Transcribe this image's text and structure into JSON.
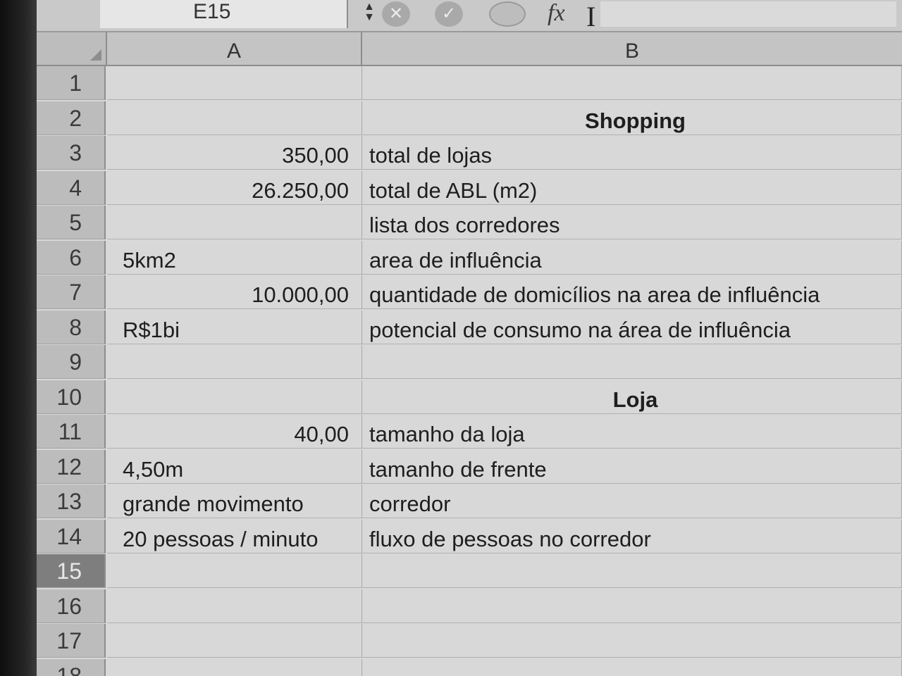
{
  "formula_bar": {
    "cell_ref": "E15",
    "cancel_icon": "close-icon",
    "confirm_icon": "check-icon",
    "function_icon": "fx-icon",
    "fx_label": "fx",
    "cursor_glyph": "I"
  },
  "columns": [
    "A",
    "B"
  ],
  "active_row": "15",
  "rows": [
    {
      "num": "1",
      "a": "",
      "b": ""
    },
    {
      "num": "2",
      "a": "",
      "b": "Shopping"
    },
    {
      "num": "3",
      "a": "350,00",
      "b": "total de lojas"
    },
    {
      "num": "4",
      "a": "26.250,00",
      "b": "total de ABL (m2)"
    },
    {
      "num": "5",
      "a": "",
      "b": "lista dos corredores"
    },
    {
      "num": "6",
      "a": "5km2",
      "b": "area de influência"
    },
    {
      "num": "7",
      "a": "10.000,00",
      "b": "quantidade de domicílios na area de influência"
    },
    {
      "num": "8",
      "a": "R$1bi",
      "b": "potencial de consumo na área de influência"
    },
    {
      "num": "9",
      "a": "",
      "b": ""
    },
    {
      "num": "10",
      "a": "",
      "b": "Loja"
    },
    {
      "num": "11",
      "a": "40,00",
      "b": "tamanho da loja"
    },
    {
      "num": "12",
      "a": "4,50m",
      "b": "tamanho de frente"
    },
    {
      "num": "13",
      "a": "grande movimento",
      "b": "corredor"
    },
    {
      "num": "14",
      "a": "20 pessoas / minuto",
      "b": "fluxo de pessoas no corredor"
    },
    {
      "num": "15",
      "a": "",
      "b": ""
    },
    {
      "num": "16",
      "a": "",
      "b": ""
    },
    {
      "num": "17",
      "a": "",
      "b": ""
    },
    {
      "num": "18",
      "a": "",
      "b": ""
    }
  ]
}
